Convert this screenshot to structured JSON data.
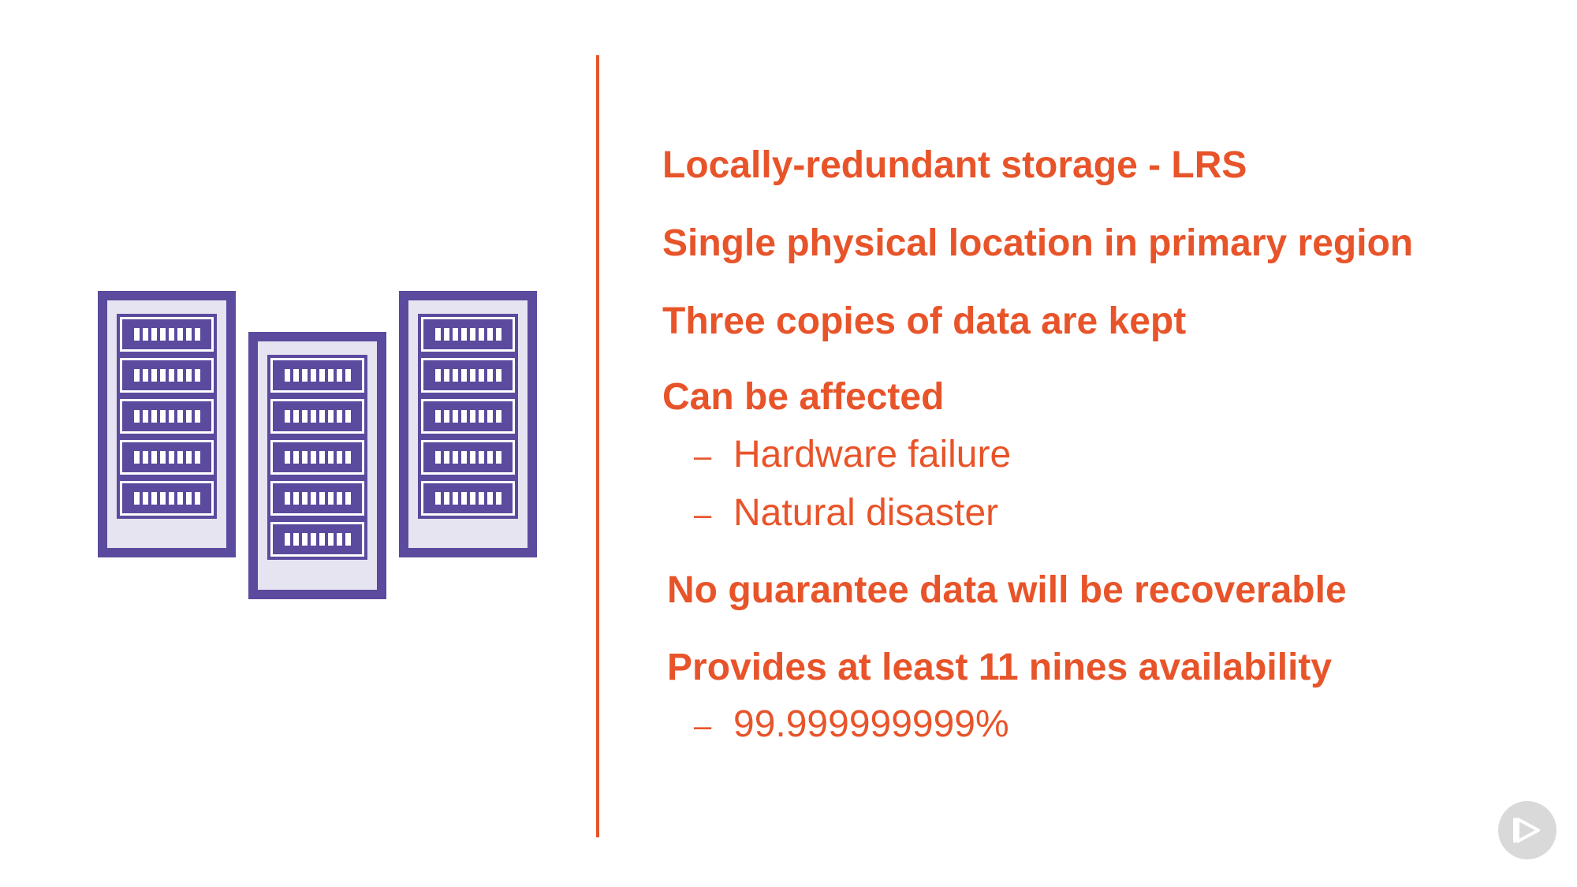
{
  "slide": {
    "bullets": [
      "Locally-redundant storage - LRS",
      "Single physical location in primary region",
      "Three copies of data are kept",
      "Can be affected",
      "No guarantee data will be recoverable",
      "Provides at least 11 nines availability"
    ],
    "sub_bullets": {
      "affected": [
        "Hardware failure",
        "Natural disaster"
      ],
      "availability": [
        "99.999999999%"
      ]
    },
    "dash": "–"
  },
  "icons": {
    "illustration": "server-racks-icon",
    "player": "play-button-icon"
  },
  "colors": {
    "accent": "#e8542a",
    "rack": "#5b4a9d",
    "rack_fill": "#e6e4f0",
    "player_bg": "#d9d9d9"
  }
}
